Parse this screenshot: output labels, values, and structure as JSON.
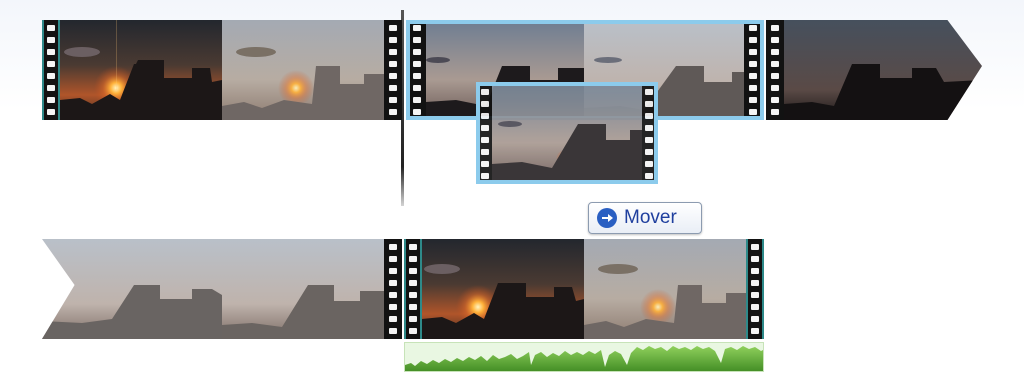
{
  "timeline": {
    "tooltip": {
      "label": "Mover",
      "icon": "right-arrow-icon"
    },
    "clips": [
      {
        "name": "clip-sunset-1",
        "row": 1,
        "selected": false
      },
      {
        "name": "clip-dusk-1",
        "row": 1,
        "selected": true
      },
      {
        "name": "clip-silhouette-1",
        "row": 1,
        "selected": false,
        "split_continues": true
      },
      {
        "name": "clip-silhouette-continued",
        "row": 2,
        "selected": false,
        "split_continued": true
      },
      {
        "name": "clip-sunset-2",
        "row": 2,
        "selected": false
      },
      {
        "name": "clip-dragging-ghost",
        "row": 1,
        "selected": true,
        "dragging": true
      }
    ],
    "audio_track": {
      "present": true,
      "color": "#5aa63a"
    },
    "colors": {
      "selection": "#8ccbec",
      "sprocket": "#121212",
      "sprocket_border": "#2e8a8a",
      "mover_text": "#1f3f9e"
    }
  }
}
